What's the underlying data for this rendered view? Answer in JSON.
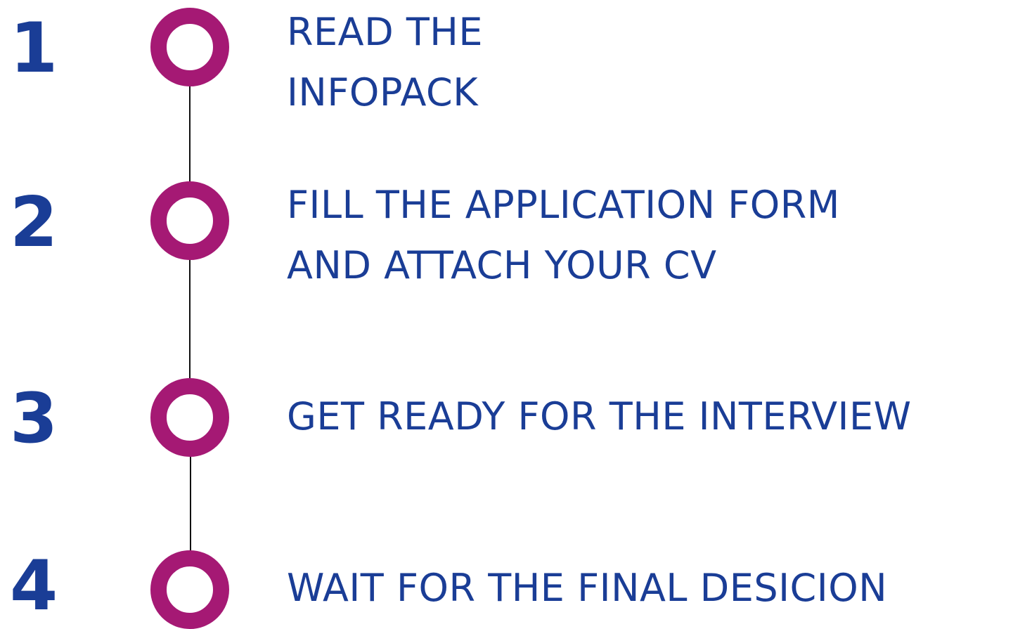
{
  "colors": {
    "number": "#1a3d96",
    "text": "#1a3d96",
    "marker": "#a51974",
    "connector": "#111111",
    "background": "#ffffff"
  },
  "steps": [
    {
      "number": "1",
      "line1": "READ THE",
      "line2": "INFOPACK"
    },
    {
      "number": "2",
      "line1": "FILL THE APPLICATION FORM",
      "line2": "AND ATTACH YOUR CV"
    },
    {
      "number": "3",
      "line1": "GET READY FOR THE INTERVIEW"
    },
    {
      "number": "4",
      "line1": "WAIT FOR THE FINAL DESICION"
    }
  ]
}
